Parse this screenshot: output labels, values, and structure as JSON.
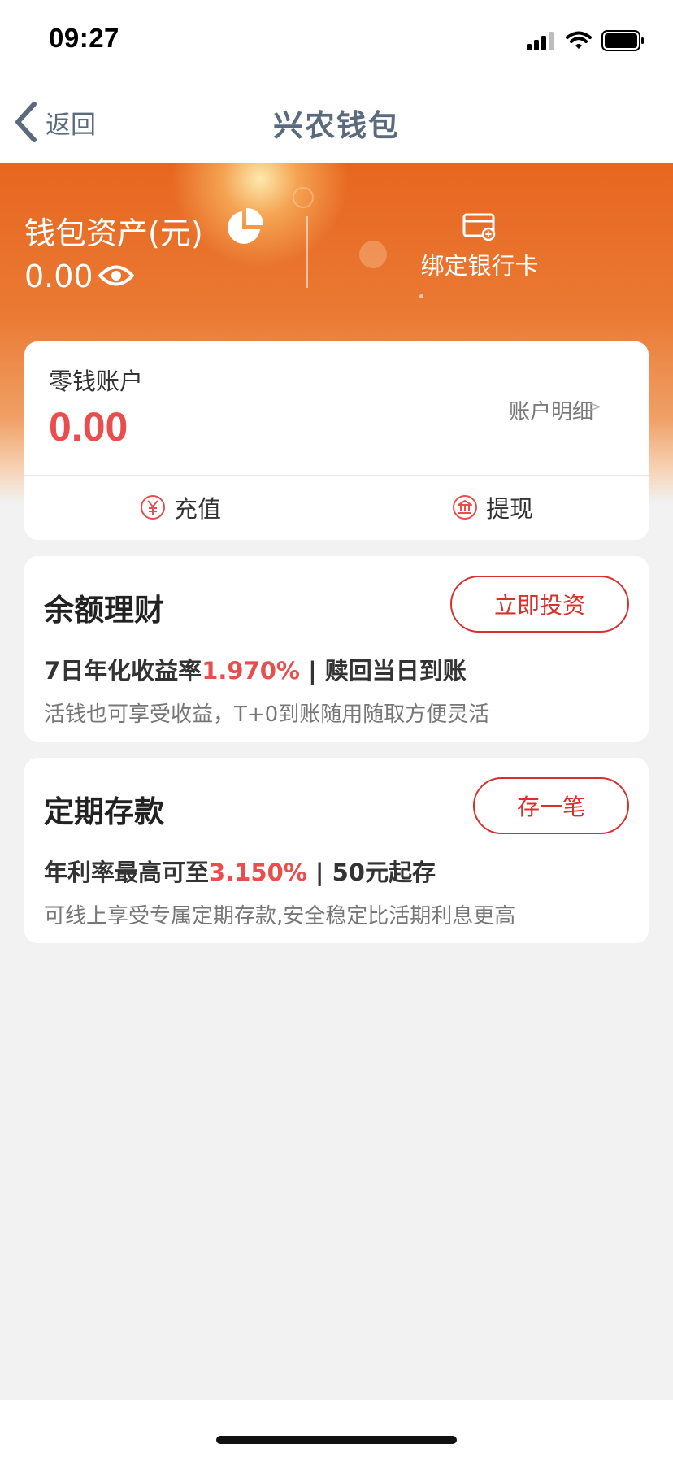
{
  "status_bar": {
    "time": "09:27",
    "icons": [
      "signal-icon",
      "wifi-icon",
      "battery-icon"
    ]
  },
  "nav": {
    "back_label": "返回",
    "title": "兴农钱包"
  },
  "wallet_summary": {
    "assets_label": "钱包资产(元)",
    "assets_value": "0.00",
    "bind_card_label": "绑定银行卡"
  },
  "change_account": {
    "label": "零钱账户",
    "balance": "0.00",
    "detail_link": "账户明细",
    "detail_chevron": ">",
    "recharge_label": "充值",
    "withdraw_label": "提现"
  },
  "products": [
    {
      "title": "余额理财",
      "button": "立即投资",
      "rate_prefix": "7日年化收益率",
      "rate_value": "1.970%",
      "rate_suffix": " | 赎回当日到账",
      "description": "活钱也可享受收益，T+0到账随用随取方便灵活"
    },
    {
      "title": "定期存款",
      "button": "存一笔",
      "rate_prefix": "年利率最高可至",
      "rate_value": "3.150%",
      "rate_suffix": " | 50元起存",
      "description": "可线上享受专属定期存款,安全稳定比活期利息更高"
    }
  ],
  "colors": {
    "accent_orange": "#e7661f",
    "highlight_red": "#e94e4e",
    "button_red": "#d9302c",
    "nav_text": "#5b6a7d",
    "background": "#f2f2f2"
  }
}
